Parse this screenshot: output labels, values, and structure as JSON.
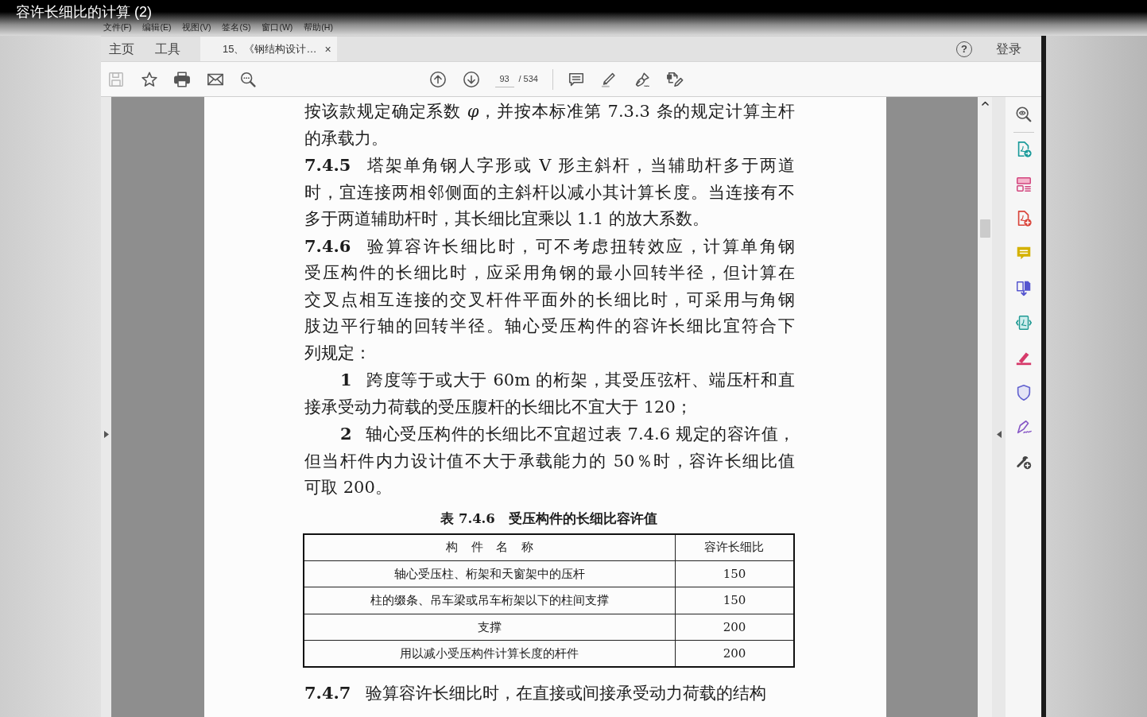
{
  "video_title": "容许长细比的计算 (2)",
  "menu": [
    "文件(F)",
    "编辑(E)",
    "视图(V)",
    "签名(S)",
    "窗口(W)",
    "帮助(H)"
  ],
  "tabs": [
    {
      "label": "主页",
      "selected": false
    },
    {
      "label": "工具",
      "selected": false
    },
    {
      "label": "15、《钢结构设计…",
      "selected": true,
      "close": "×"
    }
  ],
  "account": {
    "help": "?",
    "login": "登录"
  },
  "toolbar": {
    "save": {
      "disabled": true
    },
    "page": {
      "value": "93",
      "total": "/ 534"
    }
  },
  "document": {
    "paragraphs": [
      {
        "kind": "text",
        "lines": [
          "按该款规定确定系数 *φ*，并按本标准第 7.3.3 条的规定计算主杆",
          "的承载力。"
        ]
      },
      {
        "kind": "clause",
        "number": "7.4.5",
        "lines": [
          "塔架单角钢人字形或 V 形主斜杆，当辅助杆多于两道",
          "时，宜连接两相邻侧面的主斜杆以减小其计算长度。当连接有不",
          "多于两道辅助杆时，其长细比宜乘以 1.1 的放大系数。"
        ]
      },
      {
        "kind": "clause",
        "number": "7.4.6",
        "lines": [
          "验算容许长细比时，可不考虑扭转效应，计算单角钢",
          "受压构件的长细比时，应采用角钢的最小回转半径，但计算在",
          "交叉点相互连接的交叉杆件平面外的长细比时，可采用与角钢",
          "肢边平行轴的回转半径。轴心受压构件的容许长细比宜符合下",
          "列规定："
        ]
      },
      {
        "kind": "item",
        "number": "1",
        "lines": [
          "跨度等于或大于 60m 的桁架，其受压弦杆、端压杆和直",
          "接承受动力荷载的受压腹杆的长细比不宜大于 120；"
        ]
      },
      {
        "kind": "item",
        "number": "2",
        "lines": [
          "轴心受压构件的长细比不宜超过表 7.4.6 规定的容许值，",
          "但当杆件内力设计值不大于承载能力的 50％时，容许长细比值",
          "可取 200。"
        ]
      }
    ],
    "table": {
      "title": "表 7.4.6　受压构件的长细比容许值",
      "columns": [
        "构 件 名 称",
        "容许长细比"
      ],
      "rows": [
        [
          "轴心受压柱、桁架和天窗架中的压杆",
          "150"
        ],
        [
          "柱的缀条、吊车梁或吊车桁架以下的柱间支撑",
          "150"
        ],
        [
          "支撑",
          "200"
        ],
        [
          "用以减小受压构件计算长度的杆件",
          "200"
        ]
      ]
    },
    "more": [
      {
        "kind": "clause",
        "number": "7.4.7",
        "lines": [
          "验算容许长细比时，在直接或间接承受动力荷载的结构"
        ]
      }
    ]
  }
}
